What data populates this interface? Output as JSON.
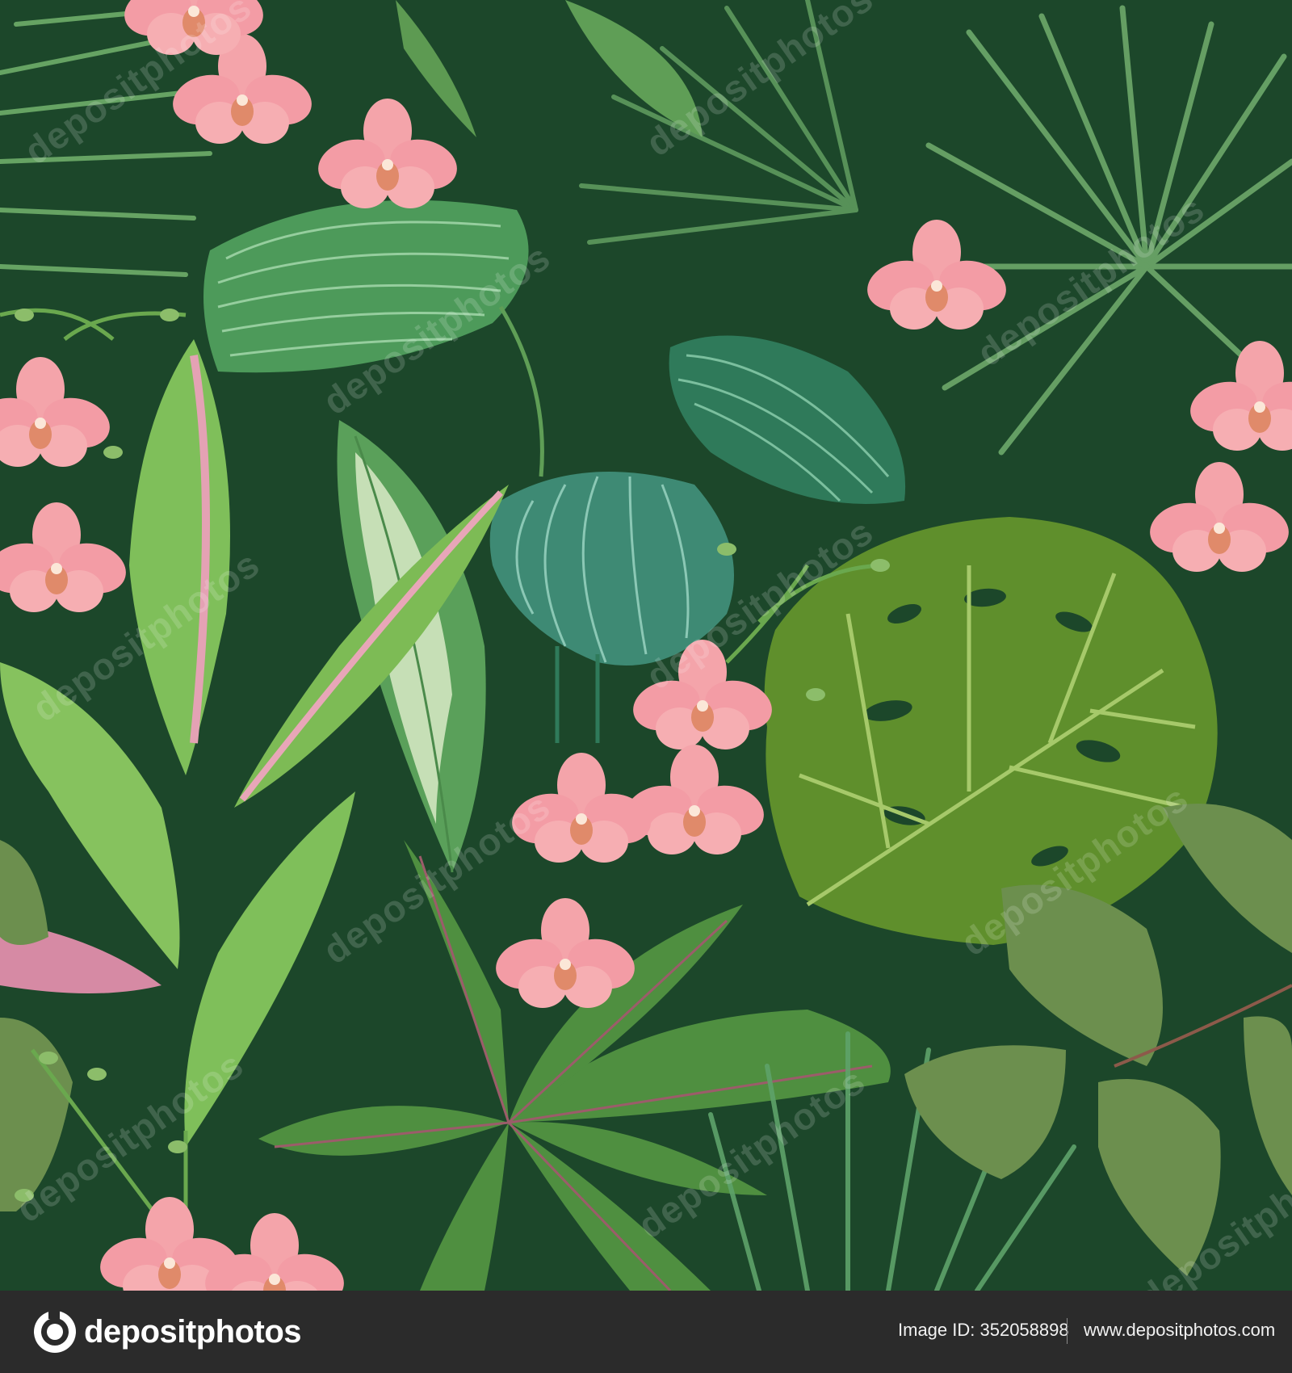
{
  "colors": {
    "background": "#1c472a",
    "orchid_pink": "#f5a3aa",
    "leaf_light": "#7db24a",
    "leaf_dark": "#3f7a3a",
    "calathea_teal": "#3e8a74",
    "footer": "#2b2b2b"
  },
  "watermark": {
    "text": "depositphotos"
  },
  "footer": {
    "logo_text": "depositphotos",
    "logo_icon": "depositphotos-logo-icon",
    "image_id": "Image ID: 352058898",
    "site_url": "www.depositphotos.com"
  }
}
